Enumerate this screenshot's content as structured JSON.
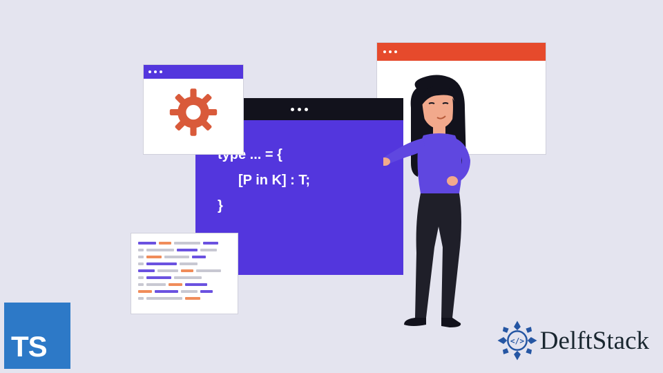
{
  "code": {
    "line1": "type ... = {",
    "line2": "[P in K] : T;",
    "line3": "}"
  },
  "brand": {
    "name": "DelftStack"
  },
  "ts_badge": {
    "label": "TS"
  },
  "colors": {
    "bg": "#e4e4ef",
    "purple": "#5336dd",
    "orange": "#e64a2c",
    "black": "#12121c",
    "ts_blue": "#2d79c7"
  }
}
